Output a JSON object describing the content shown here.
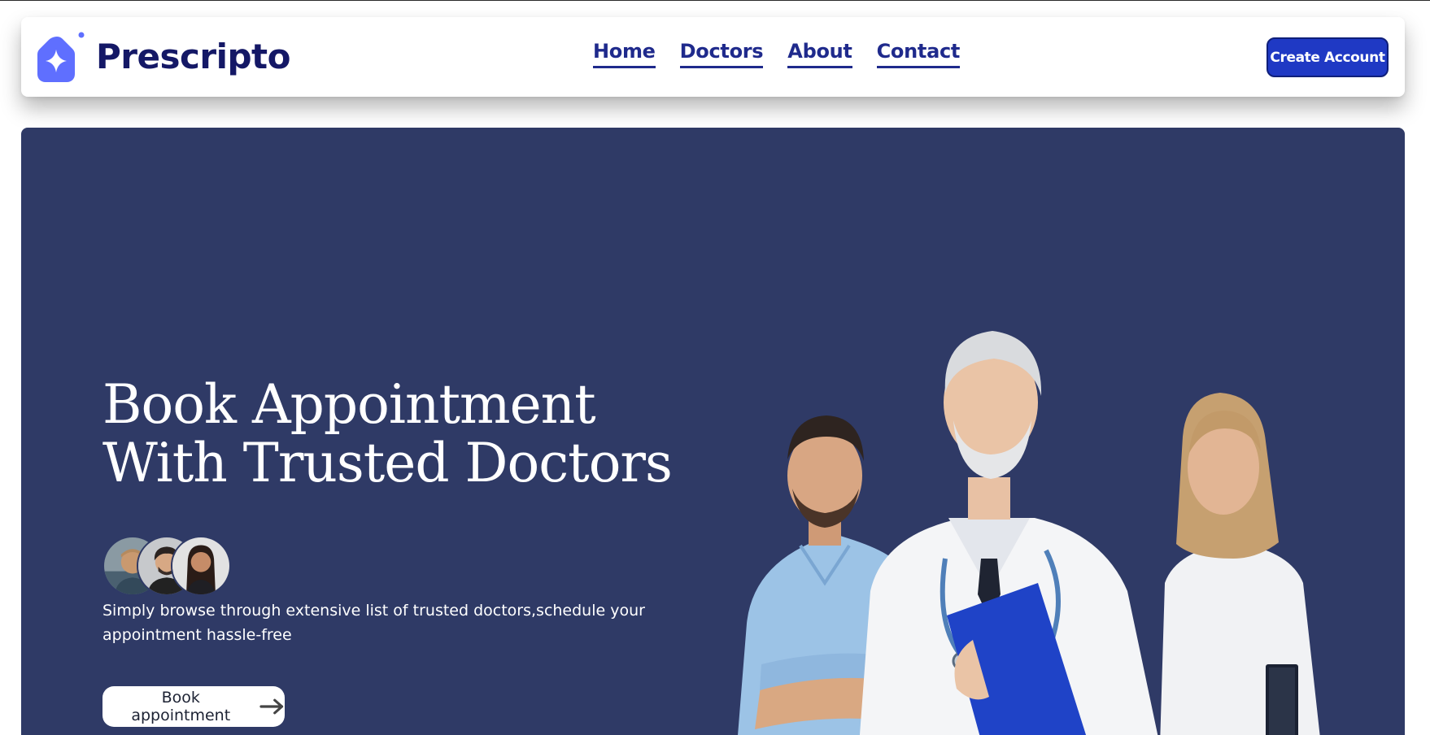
{
  "brand": {
    "name": "Prescripto",
    "logo_icon": "star-badge-icon",
    "colors": {
      "primary": "#1f39c4",
      "logo": "#5f6fff",
      "navy_text": "#141866",
      "hero_bg": "#2f3a66"
    }
  },
  "nav": {
    "links": [
      {
        "label": "Home"
      },
      {
        "label": "Doctors"
      },
      {
        "label": "About"
      },
      {
        "label": "Contact"
      }
    ],
    "cta_label": "Create Account"
  },
  "hero": {
    "title_line1": "Book Appointment",
    "title_line2": "With Trusted Doctors",
    "description": "Simply browse through extensive list of trusted doctors,schedule your appointment hassle-free",
    "button_label": "Book appointment",
    "button_icon": "arrow-right-icon"
  }
}
